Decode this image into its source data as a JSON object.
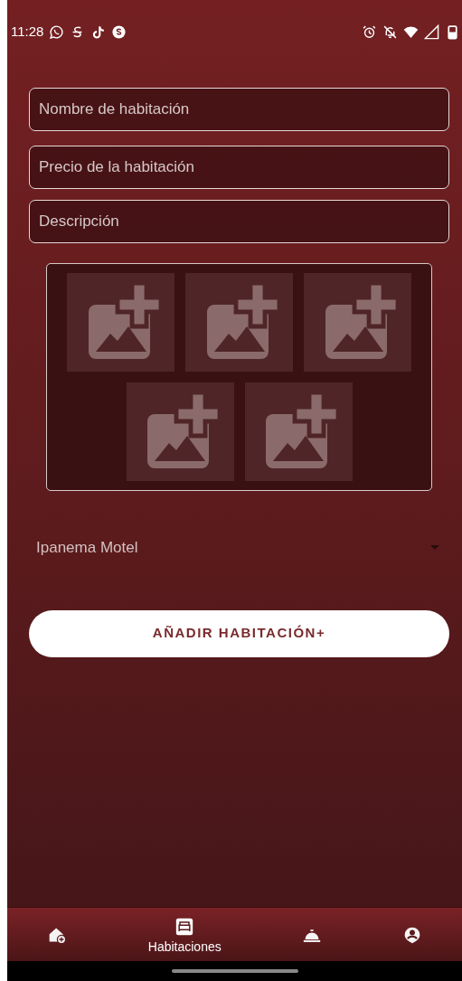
{
  "status_bar": {
    "time": "11:28"
  },
  "fields": [
    {
      "placeholder": "Nombre de habitación"
    },
    {
      "placeholder": "Precio de la habitación"
    },
    {
      "placeholder": "Descripción"
    }
  ],
  "image_slots": [
    {
      "kind": "add-image"
    },
    {
      "kind": "add-image"
    },
    {
      "kind": "add-image"
    },
    {
      "kind": "add-image"
    },
    {
      "kind": "add-image"
    }
  ],
  "dropdown": {
    "value": "Ipanema Motel"
  },
  "submit_button": {
    "label": "AÑADIR HABITACIÓN+"
  },
  "bottom_nav": [
    {
      "kind": "add-home",
      "selected": false
    },
    {
      "kind": "bed",
      "label": "Habitaciones",
      "selected": true
    },
    {
      "kind": "service-bell",
      "selected": false
    },
    {
      "kind": "account",
      "selected": false
    }
  ]
}
